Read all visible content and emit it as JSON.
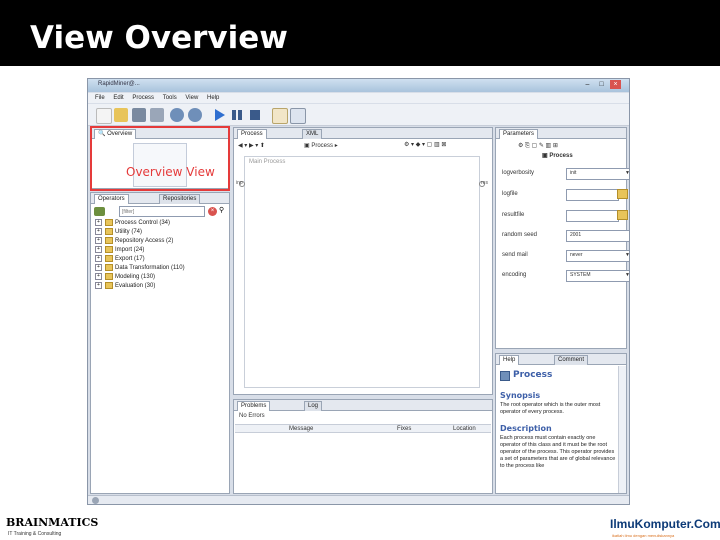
{
  "slide": {
    "title": "View Overview"
  },
  "window": {
    "title": "RapidMiner@...",
    "controls": [
      "–",
      "□",
      "×"
    ]
  },
  "menu": [
    "File",
    "Edit",
    "Process",
    "Tools",
    "View",
    "Help"
  ],
  "overview_panel": {
    "tab": "Overview"
  },
  "annotation": {
    "label": "Overview View"
  },
  "operators_panel": {
    "tabs": [
      "Operators",
      "Repositories"
    ],
    "search_placeholder": "[filter]",
    "items": [
      "Process Control (34)",
      "Utility (74)",
      "Repository Access (2)",
      "Import (24)",
      "Export (17)",
      "Data Transformation (110)",
      "Modeling (130)",
      "Evaluation (30)"
    ]
  },
  "process_panel": {
    "tabs": [
      "Process",
      "XML"
    ],
    "breadcrumb": "Process",
    "canvas_label": "Main Process",
    "port_in": "inp",
    "port_out": "res"
  },
  "parameters_panel": {
    "tab": "Parameters",
    "operator": "Process",
    "params": [
      {
        "label": "logverbosity",
        "value": "init",
        "kind": "dropdown"
      },
      {
        "label": "logfile",
        "value": "",
        "kind": "file"
      },
      {
        "label": "resultfile",
        "value": "",
        "kind": "file"
      },
      {
        "label": "random seed",
        "value": "2001",
        "kind": "text"
      },
      {
        "label": "send mail",
        "value": "never",
        "kind": "dropdown"
      },
      {
        "label": "encoding",
        "value": "SYSTEM",
        "kind": "dropdown"
      }
    ]
  },
  "help_panel": {
    "tabs": [
      "Help",
      "Comment"
    ],
    "title": "Process",
    "synopsis_heading": "Synopsis",
    "synopsis": "The root operator which is the outer most operator of every process.",
    "description_heading": "Description",
    "description": "Each process must contain exactly one operator of this class and it must be the root operator of the process. This operator provides a set of parameters that are of global relevance to the process like"
  },
  "problems_panel": {
    "tabs": [
      "Problems",
      "Log"
    ],
    "status": "No Errors",
    "columns": [
      "Message",
      "Fixes",
      "Location"
    ]
  },
  "footer": {
    "left_logo": "BRAINMATICS",
    "left_sub": "IT Training & Consulting",
    "right_logo": "IlmuKomputer.Com",
    "right_sub": "ikatlah ilmu dengan menuliskannya"
  }
}
